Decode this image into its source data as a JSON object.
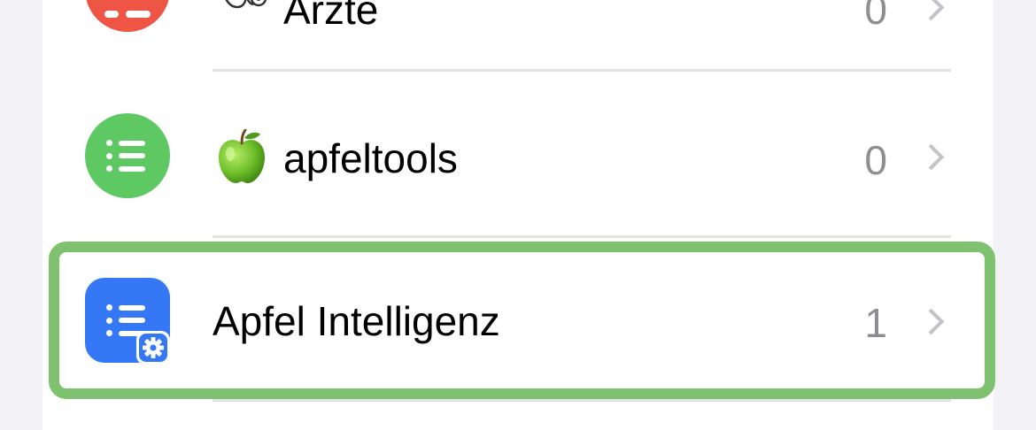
{
  "lists": [
    {
      "name": "Ärzte",
      "count": "0",
      "icon": "stethoscope-icon",
      "badge_color": "#ef5545"
    },
    {
      "name": "apfeltools",
      "count": "0",
      "icon": "green-apple-emoji",
      "badge_color": "#5ec862"
    },
    {
      "name": "Apfel Intelligenz",
      "count": "1",
      "icon": "list-gear-icon",
      "badge_color": "#3478f6",
      "highlighted": true
    }
  ],
  "colors": {
    "highlight": "#7ec16f",
    "chevron": "#c4c4c8",
    "count_text": "#8e8e93"
  }
}
